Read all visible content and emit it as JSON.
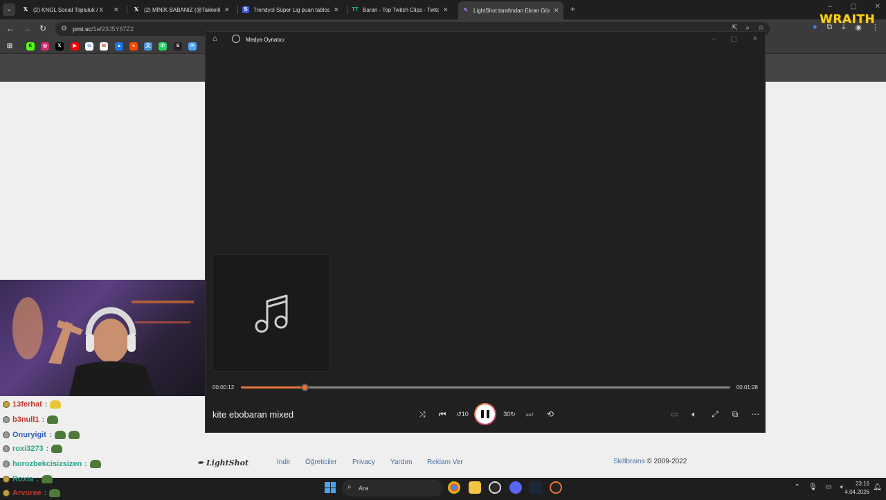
{
  "browser": {
    "tabs": [
      {
        "title": "(2) KNGL Social Topluluk / X",
        "icon": "x-logo-icon",
        "active": false
      },
      {
        "title": "(2) MİNİK BABANIZ (@TakkeliP…",
        "icon": "x-logo-icon",
        "active": false
      },
      {
        "title": "Trendyol Süper Lig puan tablosu",
        "icon": "trendyol-icon",
        "active": false
      },
      {
        "title": "Baran - Top Twitch Clips - Twitch",
        "icon": "twitchtracker-icon",
        "active": false
      },
      {
        "title": "LightShot tarafından Ekran Gör…",
        "icon": "lightshot-feather-icon",
        "active": true
      }
    ],
    "url_host": "prnt.sc",
    "url_path": "/1ef23J5Y67Z2"
  },
  "overlay": {
    "brand": "WRAITH"
  },
  "player": {
    "app_title": "Medya Oynatıcı",
    "song_title": "kite ebobaran mixed",
    "time_current": "00:00:12",
    "time_total": "00:01:28",
    "progress": 0.13,
    "accent": "#e8743d"
  },
  "page": {
    "footer_links": [
      "İndir",
      "Öğreticiler",
      "Privacy",
      "Yardım",
      "Reklam Ver"
    ],
    "logo_text": "LightShot",
    "copyright_brand": "Skillbrains",
    "copyright_years": "© 2009-2022"
  },
  "chat": [
    {
      "user": "13ferhat",
      "color": "#c0392b",
      "emotes": 1
    },
    {
      "user": "b3null1",
      "color": "#c0392b",
      "emotes": 1
    },
    {
      "user": "Onuryigit",
      "color": "#2f5fbf",
      "emotes": 2
    },
    {
      "user": "roxi3273",
      "color": "#2aa58a",
      "emotes": 1
    },
    {
      "user": "horozbekcisizsizen",
      "color": "#2aa58a",
      "emotes": 1
    },
    {
      "user": "Roxia",
      "color": "#2aa58a",
      "emotes": 1
    },
    {
      "user": "Arvoree",
      "color": "#c0392b",
      "emotes": 1
    }
  ],
  "taskbar": {
    "search_placeholder": "Ara",
    "time": "23:16",
    "date": "4.04.2026"
  }
}
